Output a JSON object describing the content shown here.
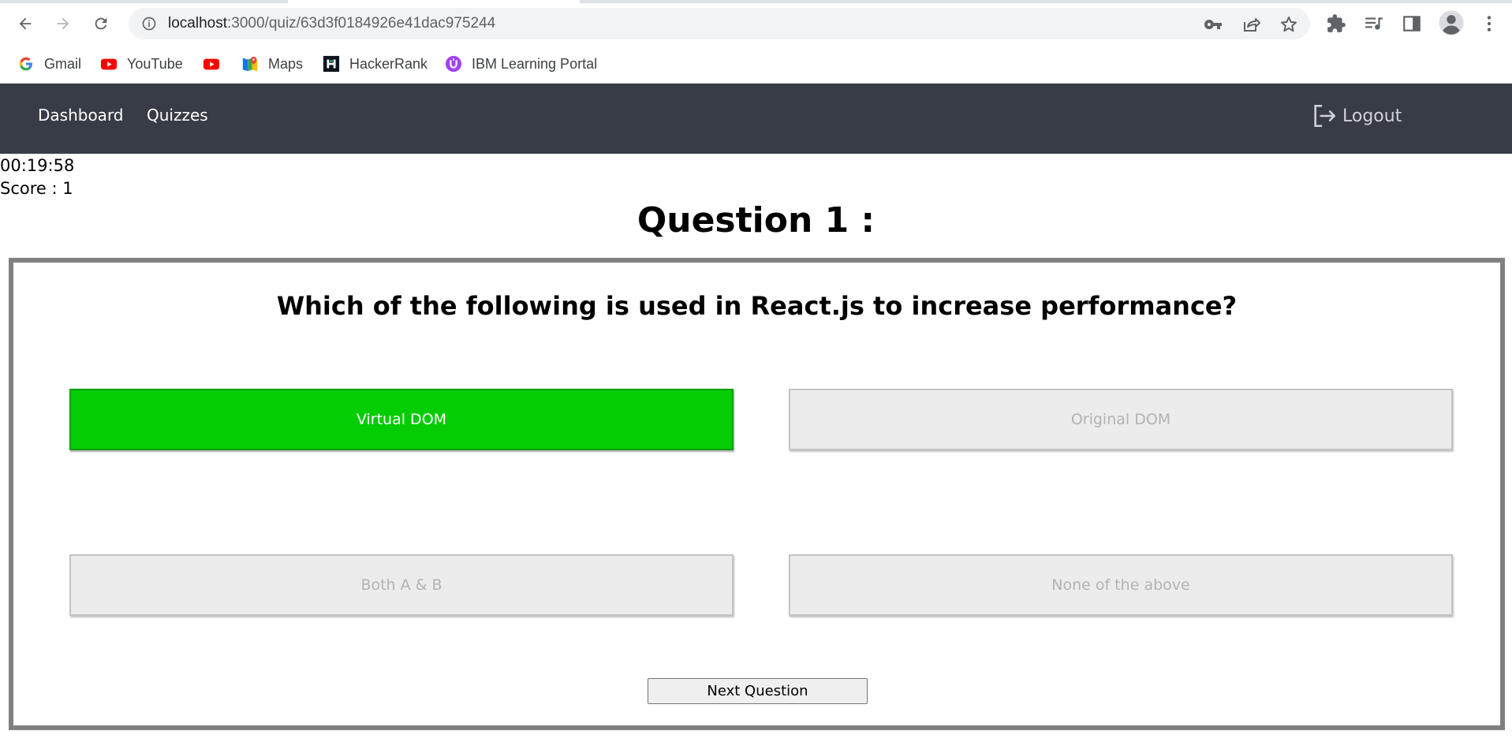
{
  "browser": {
    "url_host": "localhost",
    "url_path": ":3000/quiz/63d3f0184926e41dac975244",
    "icons": [
      "back-icon",
      "forward-icon",
      "reload-icon",
      "info-icon",
      "key-icon",
      "share-icon",
      "star-icon",
      "extensions-icon",
      "media-queue-icon",
      "side-panel-icon",
      "profile-icon",
      "menu-icon"
    ]
  },
  "bookmarks": [
    {
      "label": "Gmail",
      "icon": "google-icon"
    },
    {
      "label": "YouTube",
      "icon": "youtube-icon"
    },
    {
      "label": "",
      "icon": "youtube-icon"
    },
    {
      "label": "Maps",
      "icon": "maps-icon"
    },
    {
      "label": "HackerRank",
      "icon": "hackerrank-icon"
    },
    {
      "label": "IBM Learning Portal",
      "icon": "ibm-learning-icon"
    }
  ],
  "navbar": {
    "links": [
      "Dashboard",
      "Quizzes"
    ],
    "logout_label": "Logout",
    "background": "#383c46"
  },
  "quiz": {
    "timer": "00:19:58",
    "score": "Score : 1",
    "title": "Question 1 :",
    "question": "Which of the following is used in React.js to increase performance?",
    "options": [
      {
        "label": "Virtual DOM",
        "state": "correct"
      },
      {
        "label": "Original DOM",
        "state": "default"
      },
      {
        "label": "Both A & B",
        "state": "default"
      },
      {
        "label": "None of the above",
        "state": "default"
      }
    ],
    "next_label": "Next Question",
    "correct_color": "#04cd04",
    "border_color": "#808080"
  }
}
